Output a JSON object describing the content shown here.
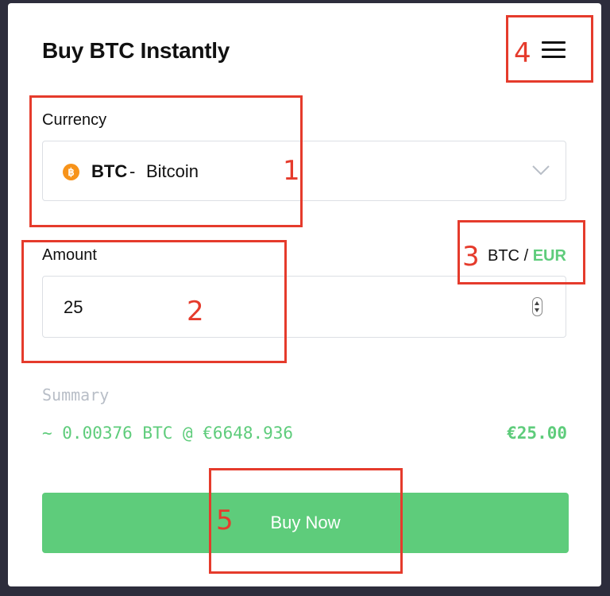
{
  "header": {
    "title": "Buy BTC Instantly"
  },
  "currency": {
    "label": "Currency",
    "icon_glyph": "฿",
    "code": "BTC",
    "separator": "-",
    "name": "Bitcoin"
  },
  "amount": {
    "label": "Amount",
    "value": "25",
    "unit_toggle": {
      "first": "BTC",
      "separator": "/",
      "second": "EUR",
      "active": "EUR"
    }
  },
  "summary": {
    "label": "Summary",
    "rate_text": "~ 0.00376 BTC @ €6648.936",
    "total": "€25.00"
  },
  "actions": {
    "buy_label": "Buy Now"
  },
  "annotations": [
    "1",
    "2",
    "3",
    "4",
    "5"
  ],
  "colors": {
    "accent_green": "#5ecc7b",
    "annotation_red": "#e53b2c",
    "bitcoin_orange": "#f7931a",
    "background": "#2d2d3c"
  }
}
